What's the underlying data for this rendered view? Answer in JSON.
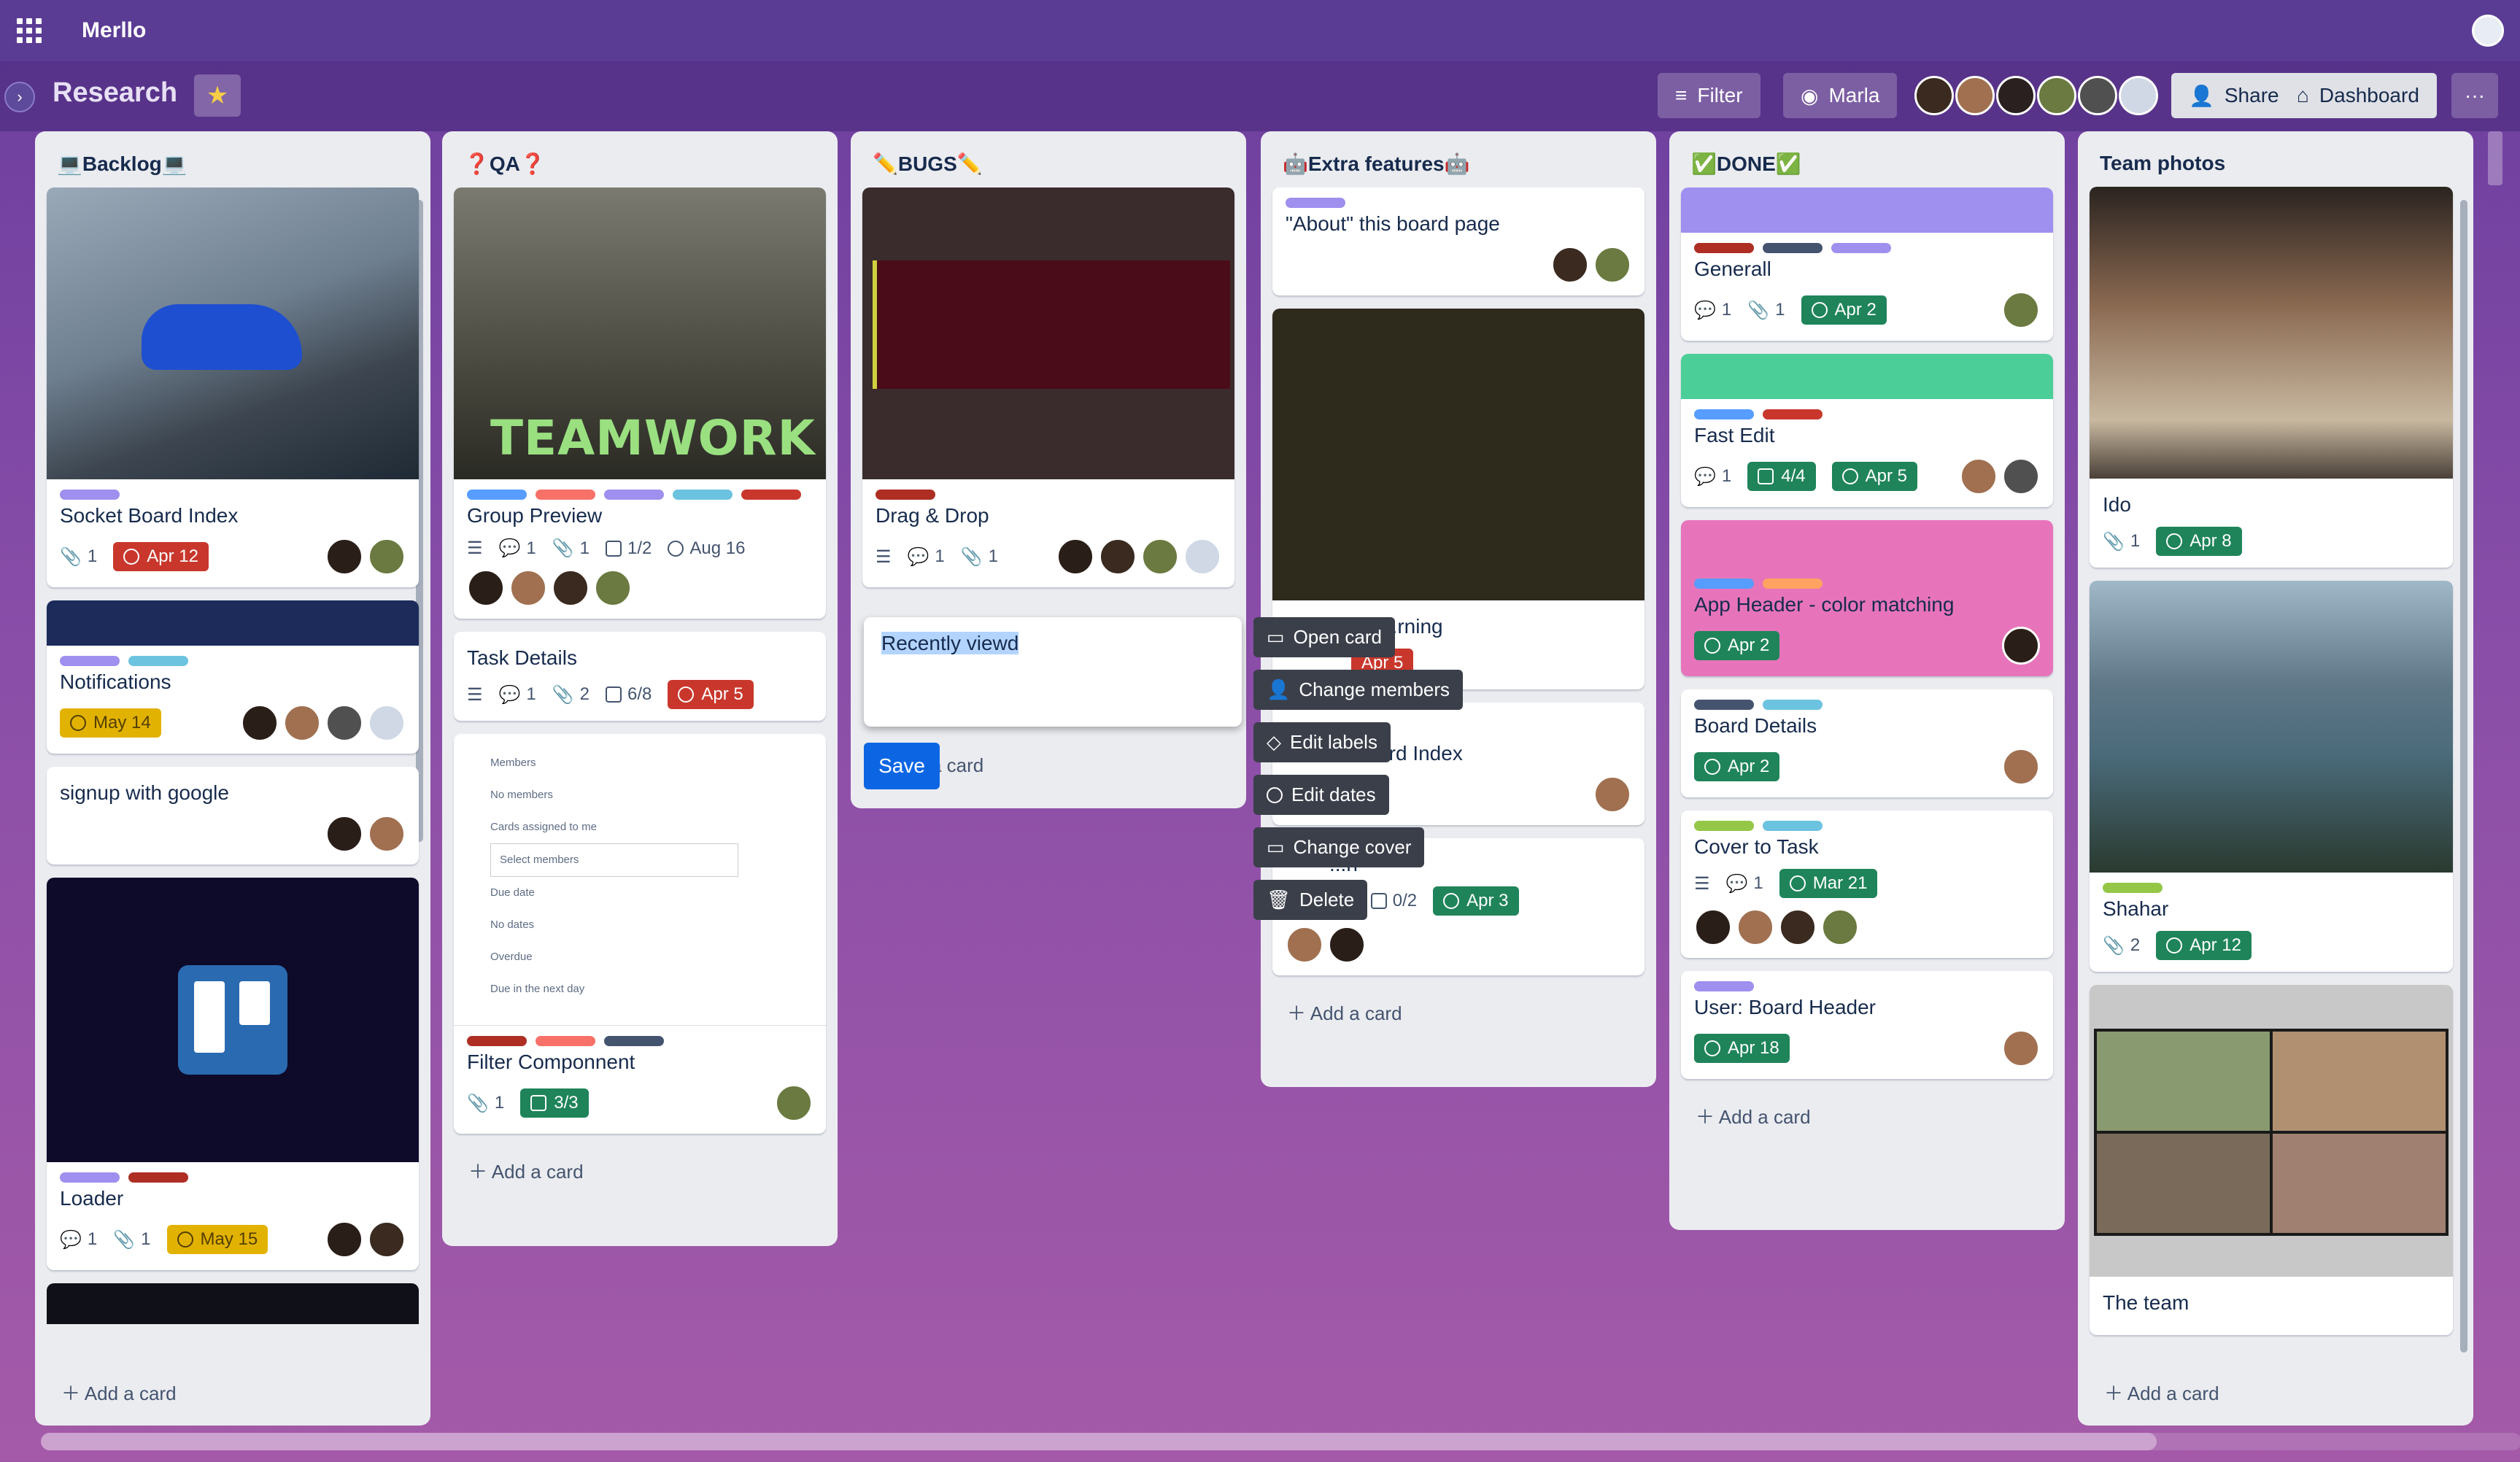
{
  "app": {
    "name": "Merllo"
  },
  "board": {
    "title": "Research",
    "filter_label": "Filter",
    "user_filter_label": "Marla",
    "share_label": "Share",
    "dashboard_label": "Dashboard",
    "more_label": "···"
  },
  "colors": {
    "accent": "#0c66e4",
    "red_badge": "#c9372c",
    "green_badge": "#1f845a",
    "yellow_badge": "#e2b203"
  },
  "lists": [
    {
      "title": "💻Backlog💻",
      "add_label": "Add a card",
      "cards": [
        {
          "title": "Socket Board Index",
          "attachments": "1",
          "due": "Apr 12"
        },
        {
          "title": "Notifications",
          "due": "May 14"
        },
        {
          "title": "signup with google"
        },
        {
          "title": "Loader",
          "comments": "1",
          "attachments": "1",
          "due": "May 15"
        }
      ]
    },
    {
      "title": "❓QA❓",
      "add_label": "Add a card",
      "cards": [
        {
          "title": "Group Preview",
          "cover_text": "TEAMWORK",
          "comments": "1",
          "attachments": "1",
          "checklist": "1/2",
          "due": "Aug 16"
        },
        {
          "title": "Task Details",
          "comments": "1",
          "attachments": "2",
          "checklist": "6/8",
          "due": "Apr 5"
        },
        {
          "title": "Filter Componnent",
          "attachments": "1",
          "checklist": "3/3",
          "cover_lines": [
            "Members",
            "No members",
            "Cards assigned to me",
            "Select members",
            "Due date",
            "No dates",
            "Overdue",
            "Due in the next day"
          ]
        }
      ]
    },
    {
      "title": "✏️BUGS✏️",
      "add_label": "a card",
      "cards": [
        {
          "title": "Drag & Drop",
          "comments": "1",
          "attachments": "1"
        }
      ]
    },
    {
      "title": "🤖Extra features🤖",
      "add_label": "Add a card",
      "cards": [
        {
          "title": "\"About\" this board page"
        },
        {
          "title": "...rning",
          "due": "Apr 5"
        },
        {
          "title": "Create Board Index"
        },
        {
          "title": "...h",
          "comments": "1",
          "checklist": "0/2",
          "due": "Apr 3"
        }
      ]
    },
    {
      "title": "✅DONE✅",
      "add_label": "Add a card",
      "cards": [
        {
          "title": "Generall",
          "comments": "1",
          "attachments": "1",
          "due": "Apr 2"
        },
        {
          "title": "Fast Edit",
          "comments": "1",
          "checklist": "4/4",
          "due": "Apr 5"
        },
        {
          "title": "App Header - color matching",
          "due": "Apr 2"
        },
        {
          "title": "Board Details",
          "due": "Apr 2"
        },
        {
          "title": "Cover to Task",
          "comments": "1",
          "due": "Mar 21"
        },
        {
          "title": "User: Board Header",
          "due": "Apr 18"
        }
      ]
    },
    {
      "title": "Team photos",
      "add_label": "Add a card",
      "cards": [
        {
          "title": "Ido",
          "attachments": "1",
          "due": "Apr 8"
        },
        {
          "title": "Shahar",
          "attachments": "2",
          "due": "Apr 12"
        },
        {
          "title": "The team"
        }
      ]
    }
  ],
  "quick_edit": {
    "text": "Recently viewd",
    "save_label": "Save",
    "menu": [
      "Open card",
      "Change members",
      "Edit labels",
      "Edit dates",
      "Change cover",
      "Delete"
    ]
  }
}
